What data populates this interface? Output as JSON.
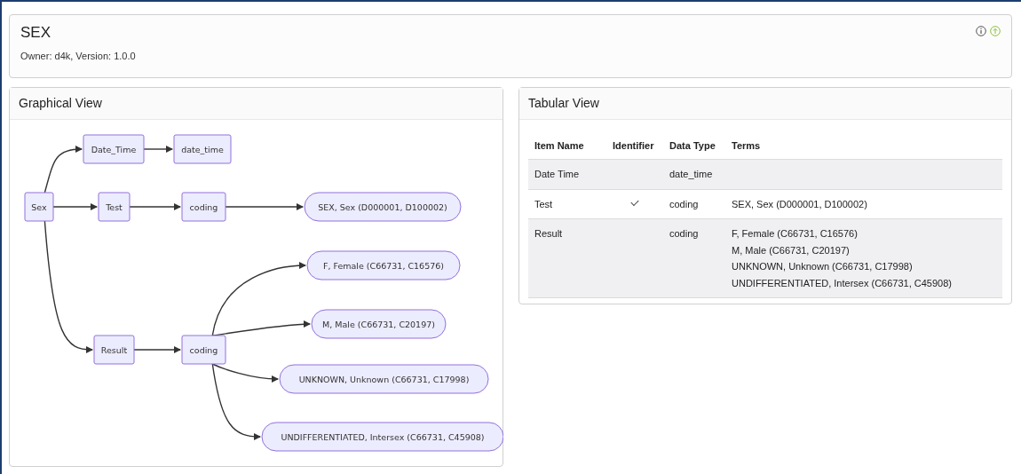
{
  "header": {
    "title": "SEX",
    "subtitle": "Owner: d4k, Version: 1.0.0"
  },
  "graph": {
    "title": "Graphical View",
    "root": {
      "label": "Sex",
      "kind": "box",
      "children": [
        {
          "label": "Date_Time",
          "kind": "box",
          "children": [
            {
              "label": "date_time",
              "kind": "box"
            }
          ]
        },
        {
          "label": "Test",
          "kind": "box",
          "children": [
            {
              "label": "coding",
              "kind": "box",
              "children": [
                {
                  "label": "SEX, Sex (D000001, D100002)",
                  "kind": "term"
                }
              ]
            }
          ]
        },
        {
          "label": "Result",
          "kind": "box",
          "children": [
            {
              "label": "coding",
              "kind": "box",
              "children": [
                {
                  "label": "F, Female (C66731, C16576)",
                  "kind": "term"
                },
                {
                  "label": "M, Male (C66731, C20197)",
                  "kind": "term"
                },
                {
                  "label": "UNKNOWN, Unknown (C66731, C17998)",
                  "kind": "term"
                },
                {
                  "label": "UNDIFFERENTIATED, Intersex (C66731, C45908)",
                  "kind": "term"
                }
              ]
            }
          ]
        }
      ]
    }
  },
  "table": {
    "title": "Tabular View",
    "columns": [
      "Item Name",
      "Identifier",
      "Data Type",
      "Terms"
    ],
    "rows": [
      {
        "item_name": "Date Time",
        "identifier": false,
        "data_type": "date_time",
        "terms": []
      },
      {
        "item_name": "Test",
        "identifier": true,
        "data_type": "coding",
        "terms": [
          "SEX, Sex (D000001, D100002)"
        ]
      },
      {
        "item_name": "Result",
        "identifier": false,
        "data_type": "coding",
        "terms": [
          "F, Female (C66731, C16576)",
          "M, Male (C66731, C20197)",
          "UNKNOWN, Unknown (C66731, C17998)",
          "UNDIFFERENTIATED, Intersex (C66731, C45908)"
        ]
      }
    ]
  }
}
